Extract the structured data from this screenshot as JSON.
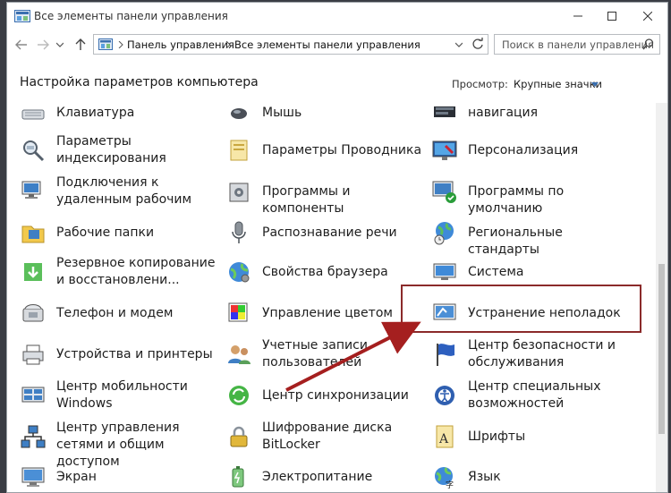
{
  "window": {
    "title": "Все элементы панели управления"
  },
  "address": {
    "crumbs": [
      "Панель управления",
      "Все элементы панели управления"
    ]
  },
  "search": {
    "placeholder": "Поиск в панели управления"
  },
  "page": {
    "heading": "Настройка параметров компьютера",
    "view_label": "Просмотр:",
    "view_value": "Крупные значки"
  },
  "items": [
    {
      "label": "Клавиатура",
      "icon": "keyboard-icon"
    },
    {
      "label": "Мышь",
      "icon": "mouse-icon"
    },
    {
      "label": "навигация",
      "icon": "navigation-icon"
    },
    {
      "label": "Параметры индексирования",
      "icon": "indexing-icon"
    },
    {
      "label": "Параметры Проводника",
      "icon": "explorer-options-icon"
    },
    {
      "label": "Персонализация",
      "icon": "personalization-icon"
    },
    {
      "label": "Подключения к удаленным рабочим",
      "icon": "remote-connections-icon"
    },
    {
      "label": "Программы и компоненты",
      "icon": "programs-icon"
    },
    {
      "label": "Программы по умолчанию",
      "icon": "default-programs-icon"
    },
    {
      "label": "Рабочие папки",
      "icon": "work-folders-icon"
    },
    {
      "label": "Распознавание речи",
      "icon": "microphone-icon"
    },
    {
      "label": "Региональные стандарты",
      "icon": "region-icon"
    },
    {
      "label": "Резервное копирование и восстановлени...",
      "icon": "backup-icon"
    },
    {
      "label": "Свойства браузера",
      "icon": "browser-properties-icon"
    },
    {
      "label": "Система",
      "icon": "system-icon"
    },
    {
      "label": "Телефон и модем",
      "icon": "phone-modem-icon"
    },
    {
      "label": "Управление цветом",
      "icon": "color-management-icon"
    },
    {
      "label": "Устранение неполадок",
      "icon": "troubleshooting-icon"
    },
    {
      "label": "Устройства и принтеры",
      "icon": "devices-printers-icon"
    },
    {
      "label": "Учетные записи пользователей",
      "icon": "user-accounts-icon"
    },
    {
      "label": "Центр безопасности и обслуживания",
      "icon": "security-flag-icon"
    },
    {
      "label": "Центр мобильности Windows",
      "icon": "mobility-center-icon"
    },
    {
      "label": "Центр синхронизации",
      "icon": "sync-center-icon"
    },
    {
      "label": "Центр специальных возможностей",
      "icon": "accessibility-icon"
    },
    {
      "label": "Центр управления сетями и общим доступом",
      "icon": "network-center-icon"
    },
    {
      "label": "Шифрование диска BitLocker",
      "icon": "bitlocker-icon"
    },
    {
      "label": "Шрифты",
      "icon": "fonts-icon"
    },
    {
      "label": "Экран",
      "icon": "display-icon"
    },
    {
      "label": "Электропитание",
      "icon": "power-icon"
    },
    {
      "label": "Язык",
      "icon": "language-icon"
    }
  ]
}
